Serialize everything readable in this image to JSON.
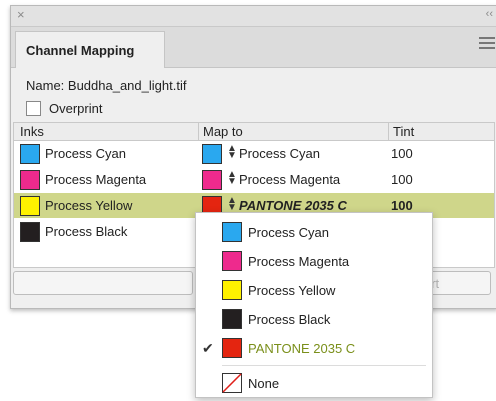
{
  "window": {
    "close_glyph": "×",
    "collapse_glyph": "‹‹"
  },
  "tab": {
    "label": "Channel Mapping"
  },
  "name_line": "Name: Buddha_and_light.tif",
  "overprint": {
    "label": "Overprint",
    "checked": false
  },
  "columns": {
    "inks": "Inks",
    "map_to": "Map to",
    "tint": "Tint"
  },
  "rows": [
    {
      "ink": "Process Cyan",
      "ink_color": "#2aa8ef",
      "map": "Process Cyan",
      "map_color": "#2aa8ef",
      "tint": "100",
      "selected": false
    },
    {
      "ink": "Process Magenta",
      "ink_color": "#ee2a8d",
      "map": "Process Magenta",
      "map_color": "#ee2a8d",
      "tint": "100",
      "selected": false
    },
    {
      "ink": "Process Yellow",
      "ink_color": "#fff200",
      "map": "PANTONE 2035 C",
      "map_color": "#e42510",
      "tint": "100",
      "selected": true
    },
    {
      "ink": "Process Black",
      "ink_color": "#231f20",
      "map": "",
      "map_color": "",
      "tint": "",
      "selected": false
    }
  ],
  "buttons": {
    "partial_label": "ert"
  },
  "dropdown": {
    "items": [
      {
        "label": "Process Cyan",
        "color": "#2aa8ef",
        "checked": false
      },
      {
        "label": "Process Magenta",
        "color": "#ee2a8d",
        "checked": false
      },
      {
        "label": "Process Yellow",
        "color": "#fff200",
        "checked": false
      },
      {
        "label": "Process Black",
        "color": "#231f20",
        "checked": false
      },
      {
        "label": "PANTONE 2035 C",
        "color": "#e42510",
        "checked": true,
        "label_color": "#7a8f1a"
      }
    ],
    "none_label": "None",
    "check_glyph": "✔"
  },
  "colors": {
    "selected_row": "#cfd68a",
    "checked_item_text": "#7a8f1a"
  }
}
